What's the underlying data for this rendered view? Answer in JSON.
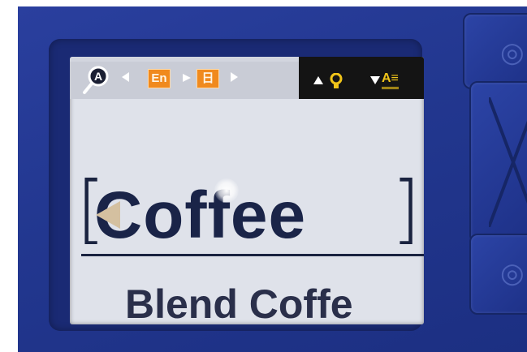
{
  "screen": {
    "headword": "Coffee",
    "candidate": "Blend Coffe",
    "bracket_left": "[",
    "bracket_right": "]"
  },
  "status_bar": {
    "source_lang": "En",
    "target_lang": "日",
    "search_icon": "magnifier-a-icon",
    "font_size_label": "A≡"
  },
  "colors": {
    "device": "#22378f",
    "screen": "#dfe2ea",
    "lang_badge": "#f08a1e",
    "icon_yellow": "#f0c419",
    "text": "#1a2448"
  }
}
